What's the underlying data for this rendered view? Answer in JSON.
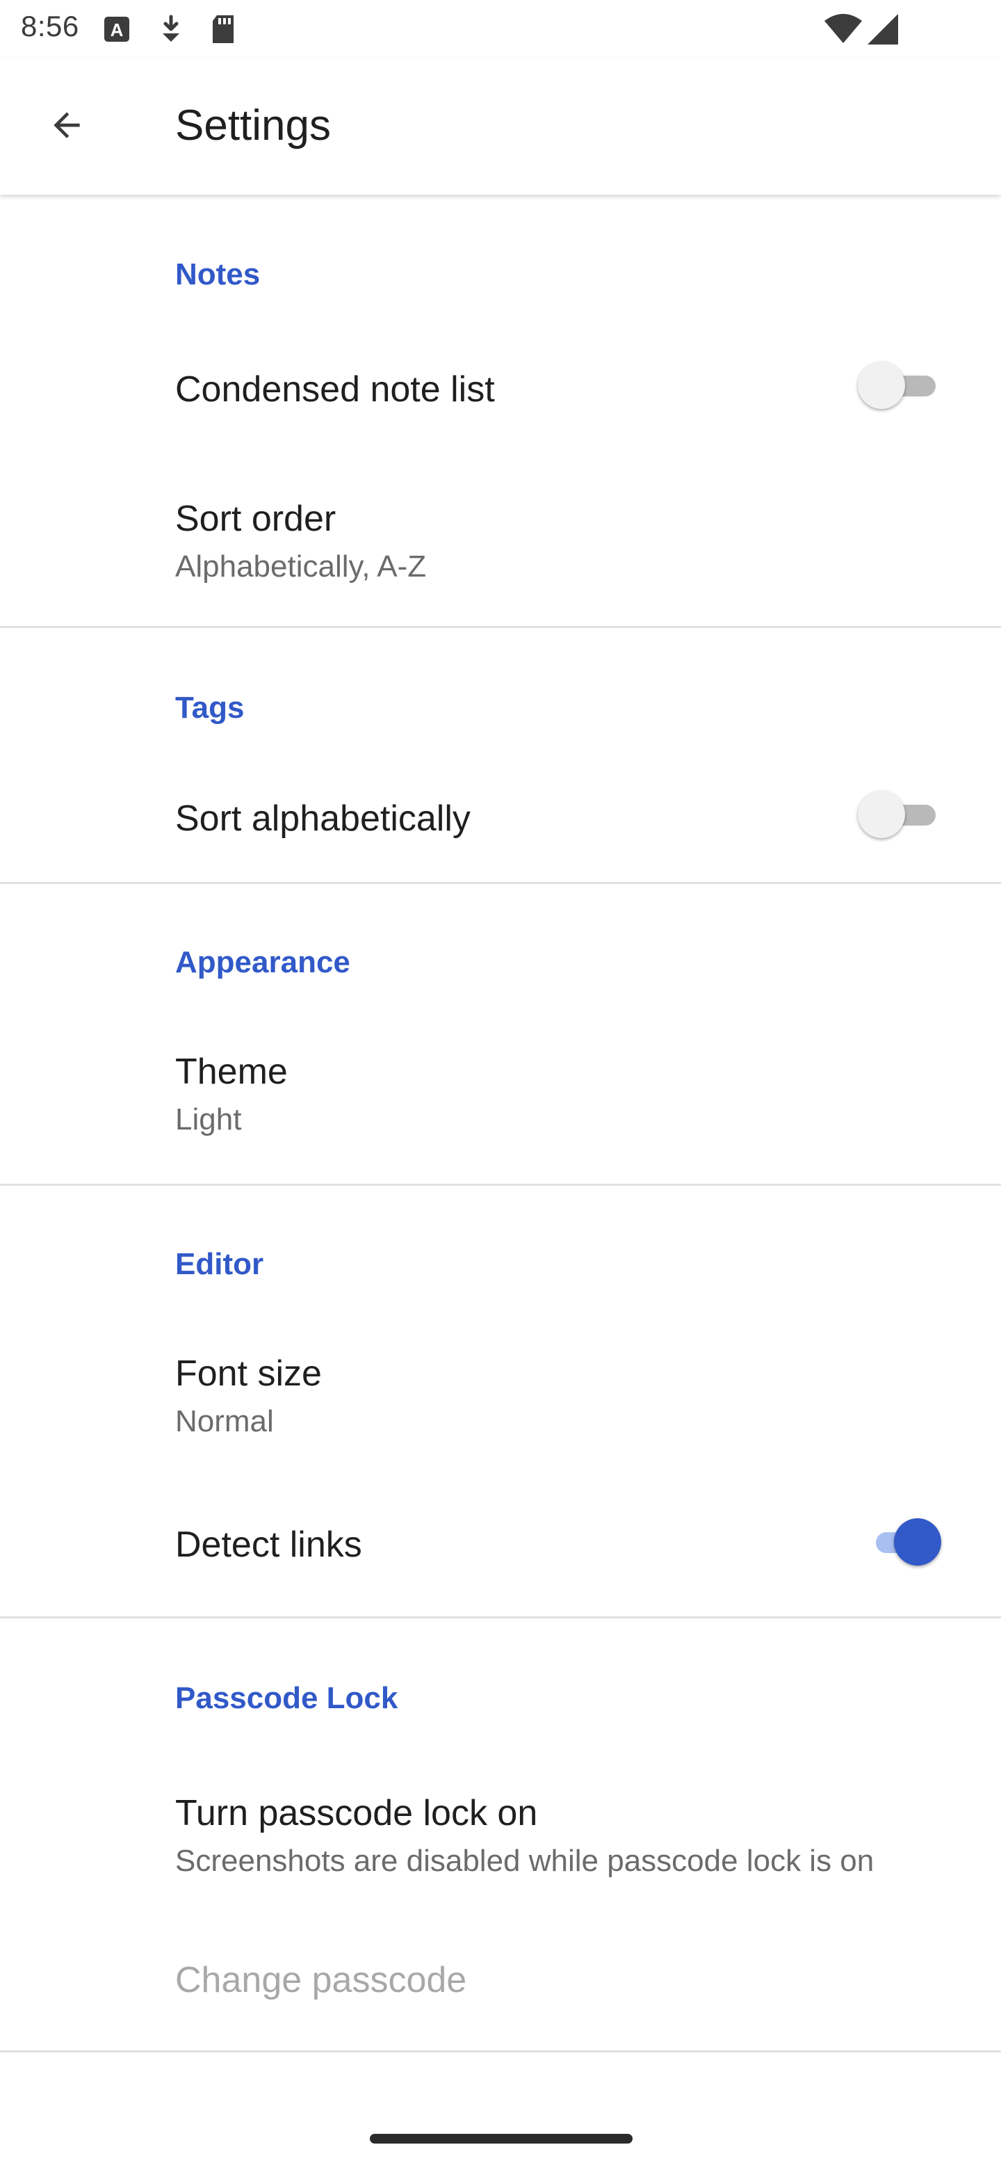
{
  "status_bar": {
    "time": "8:56"
  },
  "app_bar": {
    "title": "Settings",
    "back_icon": "arrow-back-icon"
  },
  "sections": {
    "notes": {
      "header": "Notes",
      "condensed_note_list": {
        "title": "Condensed note list",
        "enabled": false
      },
      "sort_order": {
        "title": "Sort order",
        "summary": "Alphabetically, A-Z"
      }
    },
    "tags": {
      "header": "Tags",
      "sort_alphabetically": {
        "title": "Sort alphabetically",
        "enabled": false
      }
    },
    "appearance": {
      "header": "Appearance",
      "theme": {
        "title": "Theme",
        "summary": "Light"
      }
    },
    "editor": {
      "header": "Editor",
      "font_size": {
        "title": "Font size",
        "summary": "Normal"
      },
      "detect_links": {
        "title": "Detect links",
        "enabled": true
      }
    },
    "passcode_lock": {
      "header": "Passcode Lock",
      "turn_on": {
        "title": "Turn passcode lock on",
        "summary": "Screenshots are disabled while passcode lock is on"
      },
      "change_passcode": {
        "title": "Change passcode",
        "enabled": false
      }
    }
  },
  "colors": {
    "accent": "#3159c8",
    "divider": "#e0e0e0",
    "disabled_text": "#a8a8a8"
  }
}
